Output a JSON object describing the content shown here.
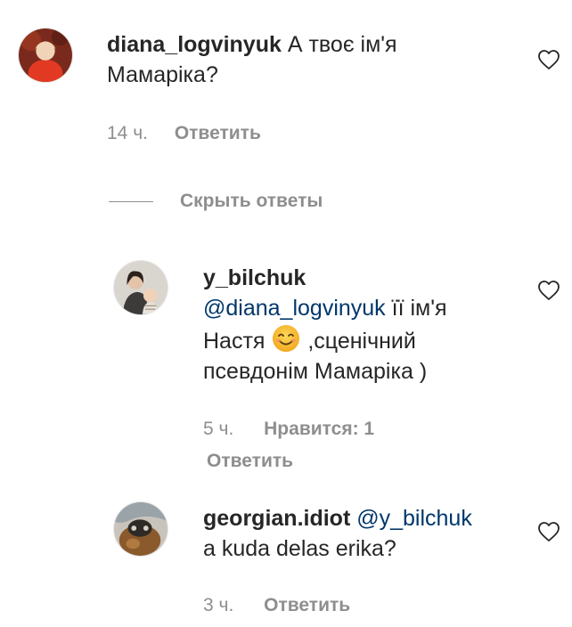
{
  "comments": [
    {
      "username": "diana_logvinyuk",
      "text": "А твоє ім'я Мамаріка?",
      "time": "14 ч.",
      "reply_label": "Ответить"
    }
  ],
  "hide_replies_label": "Скрыть ответы",
  "replies": [
    {
      "username": "y_bilchuk",
      "mention": "@diana_logvinyuk",
      "text_part1": " її ім'я Настя ",
      "emoji": "smiling-face",
      "text_part2": " ,сценічний псевдонім Мамаріка )",
      "time": "5 ч.",
      "likes_label": "Нравится: 1",
      "reply_label": "Ответить"
    },
    {
      "username": "georgian.idiot",
      "mention": "@y_bilchuk",
      "text": "a kuda delas erika?",
      "time": "3 ч.",
      "reply_label": "Ответить"
    }
  ],
  "icons": {
    "like": "heart-outline-icon"
  },
  "colors": {
    "text": "#262626",
    "secondary": "#8e8e8e",
    "mention": "#00376b"
  }
}
